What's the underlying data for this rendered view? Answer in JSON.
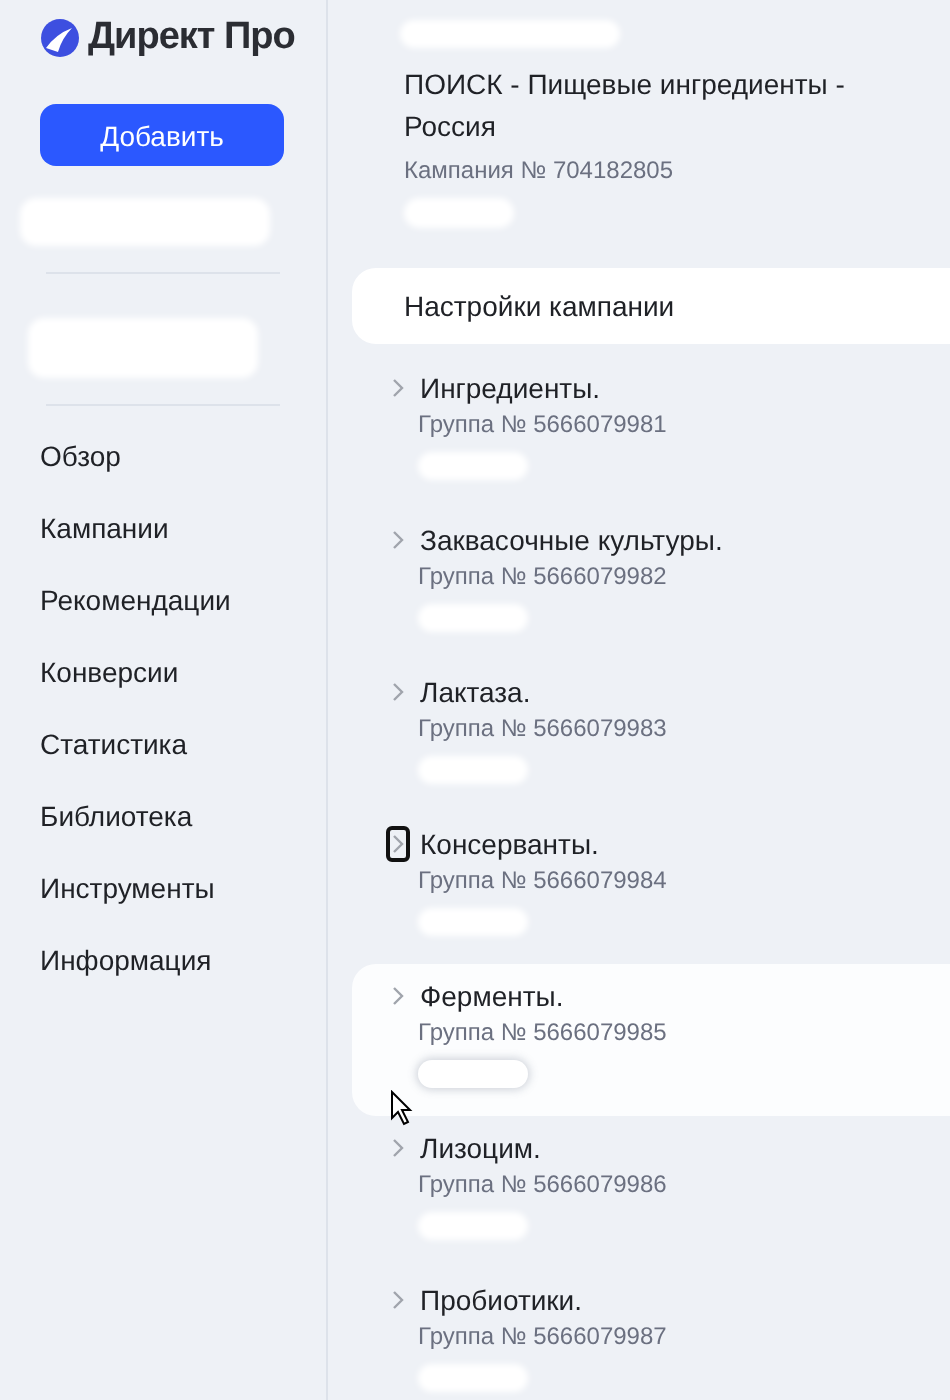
{
  "sidebar": {
    "logo": "Директ Про",
    "add_button": "Добавить",
    "nav": [
      {
        "label": "Обзор"
      },
      {
        "label": "Кампании"
      },
      {
        "label": "Рекомендации"
      },
      {
        "label": "Конверсии"
      },
      {
        "label": "Статистика"
      },
      {
        "label": "Библиотека"
      },
      {
        "label": "Инструменты"
      },
      {
        "label": "Информация"
      }
    ]
  },
  "campaign": {
    "title": "ПОИСК - Пищевые ингредиенты - Россия",
    "number": "Кампания № 704182805"
  },
  "settings_item": {
    "label": "Настройки кампании",
    "selected": true
  },
  "groups": [
    {
      "name": "Ингредиенты.",
      "number": "Группа № 5666079981",
      "hovered": false,
      "focused": false
    },
    {
      "name": "Заквасочные культуры.",
      "number": "Группа № 5666079982",
      "hovered": false,
      "focused": false
    },
    {
      "name": "Лактаза.",
      "number": "Группа № 5666079983",
      "hovered": false,
      "focused": false
    },
    {
      "name": "Консерванты.",
      "number": "Группа № 5666079984",
      "hovered": false,
      "focused": true
    },
    {
      "name": "Ферменты.",
      "number": "Группа № 5666079985",
      "hovered": true,
      "focused": false
    },
    {
      "name": "Лизоцим.",
      "number": "Группа № 5666079986",
      "hovered": false,
      "focused": false
    },
    {
      "name": "Пробиотики.",
      "number": "Группа № 5666079987",
      "hovered": false,
      "focused": false
    }
  ]
}
